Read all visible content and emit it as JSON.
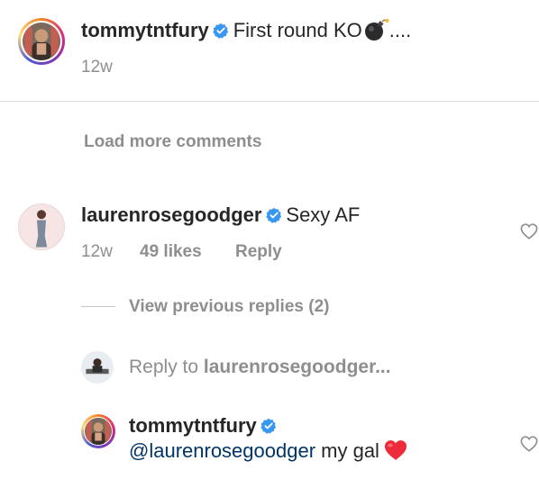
{
  "comments": [
    {
      "username": "tommytntfury",
      "text": "First round KO",
      "text_suffix": "....",
      "time": "12w"
    }
  ],
  "load_more_label": "Load more comments",
  "second_comment": {
    "username": "laurenrosegoodger",
    "text": "Sexy AF",
    "time": "12w",
    "likes": "49 likes",
    "reply_label": "Reply"
  },
  "view_previous_label": "View previous replies (2)",
  "reply_to": {
    "prefix": "Reply to ",
    "username": "laurenrosegoodger...",
    "placeholder": "Reply to laurenrosegoodger..."
  },
  "reply_comment": {
    "username": "tommytntfury",
    "mention": "@laurenrosegoodger",
    "text": " my gal"
  },
  "colors": {
    "verified": "#3897f0",
    "heart": "#ed4956",
    "muted": "#8e8e8e",
    "text": "#262626"
  },
  "icons": [
    "verified-badge-icon",
    "bomb-emoji-icon",
    "heart-outline-icon",
    "red-heart-emoji-icon"
  ]
}
